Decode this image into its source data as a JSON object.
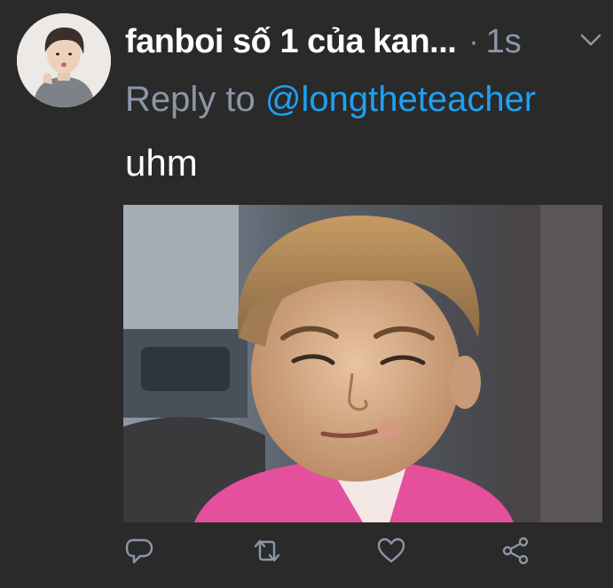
{
  "tweet": {
    "display_name": "fanboi số 1 của kan...",
    "separator": "·",
    "time": "1s",
    "reply_prefix": "Reply to",
    "reply_handle": "@longtheteacher",
    "text": "uhm"
  },
  "icons": {
    "more": "chevron-down-icon",
    "reply": "reply-icon",
    "retweet": "retweet-icon",
    "like": "heart-icon",
    "share": "share-icon"
  },
  "colors": {
    "background": "#2a2a2a",
    "muted": "#8b97a6",
    "link": "#1da1f2",
    "text": "#ffffff"
  }
}
